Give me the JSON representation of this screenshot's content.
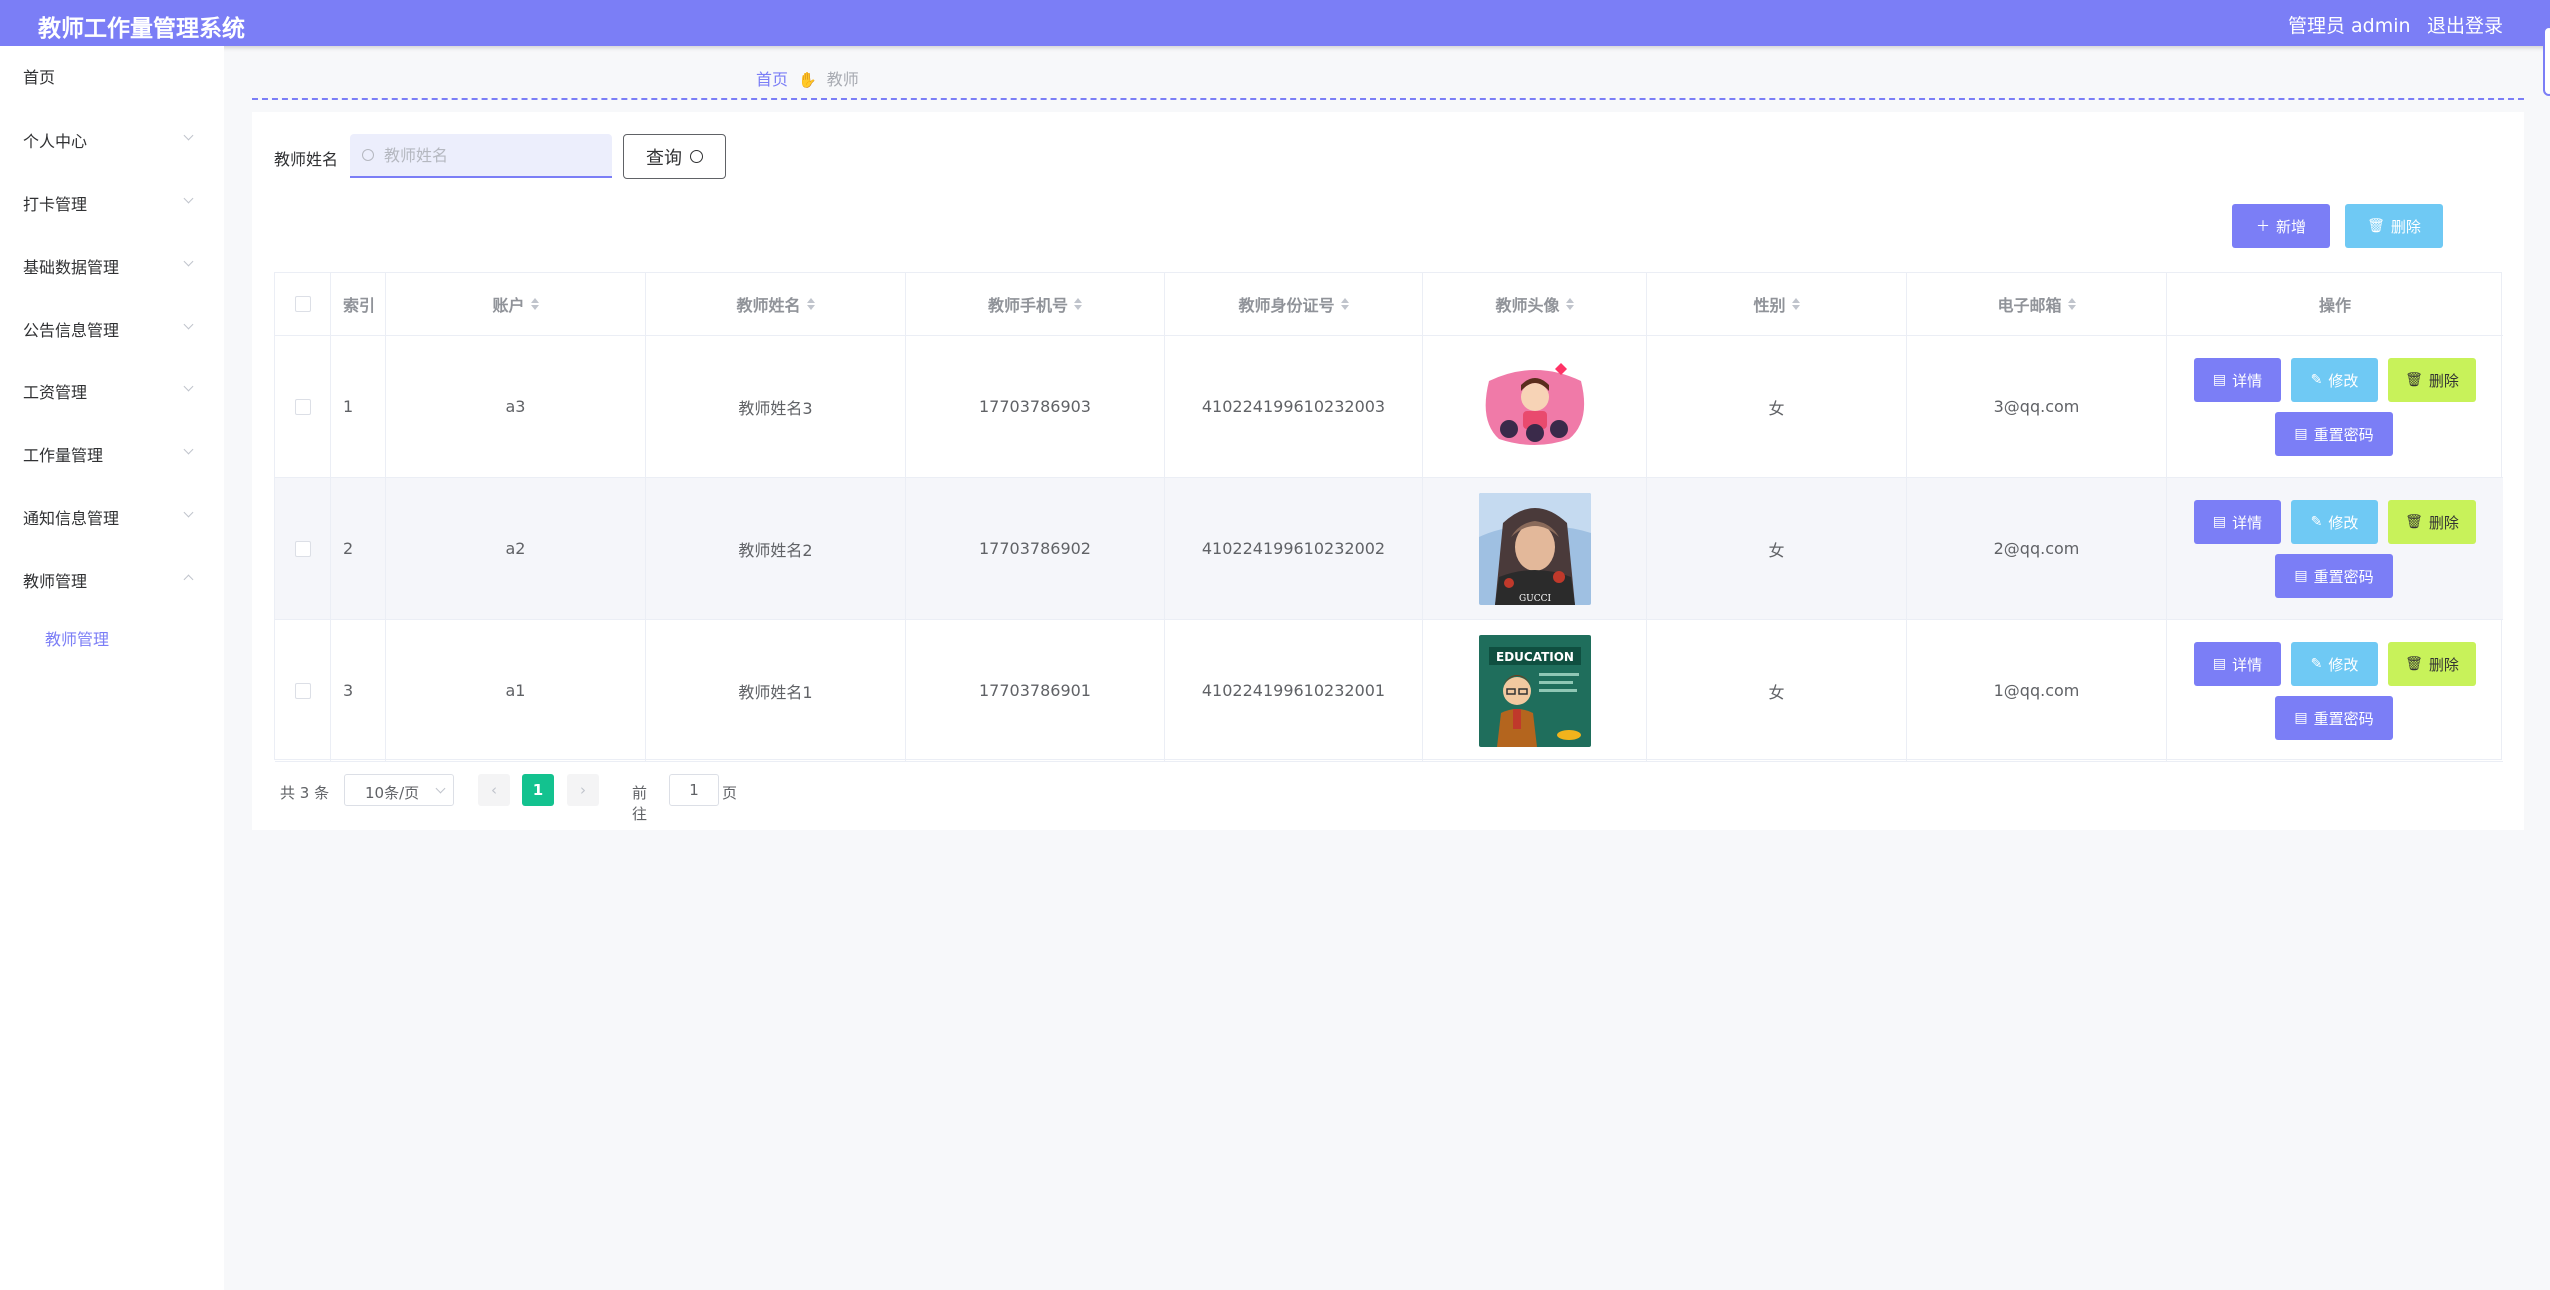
{
  "header": {
    "title": "教师工作量管理系统",
    "admin": "管理员 admin",
    "logout": "退出登录"
  },
  "sidebar": {
    "items": [
      {
        "label": "首页"
      },
      {
        "label": "个人中心"
      },
      {
        "label": "打卡管理"
      },
      {
        "label": "基础数据管理"
      },
      {
        "label": "公告信息管理"
      },
      {
        "label": "工资管理"
      },
      {
        "label": "工作量管理"
      },
      {
        "label": "通知信息管理"
      },
      {
        "label": "教师管理"
      }
    ],
    "active_sub": "教师管理"
  },
  "breadcrumb": {
    "home": "首页",
    "current": "教师"
  },
  "search": {
    "label": "教师姓名",
    "placeholder": "教师姓名",
    "button": "查询"
  },
  "actions": {
    "add": "新增",
    "delete": "删除"
  },
  "table": {
    "columns": {
      "index": "索引",
      "account": "账户",
      "name": "教师姓名",
      "phone": "教师手机号",
      "idcard": "教师身份证号",
      "avatar": "教师头像",
      "gender": "性别",
      "email": "电子邮箱",
      "ops": "操作"
    },
    "rows": [
      {
        "index": "1",
        "account": "a3",
        "name": "教师姓名3",
        "phone": "17703786903",
        "idcard": "410224199610232003",
        "gender": "女",
        "email": "3@qq.com"
      },
      {
        "index": "2",
        "account": "a2",
        "name": "教师姓名2",
        "phone": "17703786902",
        "idcard": "410224199610232002",
        "gender": "女",
        "email": "2@qq.com"
      },
      {
        "index": "3",
        "account": "a1",
        "name": "教师姓名1",
        "phone": "17703786901",
        "idcard": "410224199610232001",
        "gender": "女",
        "email": "1@qq.com"
      }
    ],
    "row_actions": {
      "detail": "详情",
      "edit": "修改",
      "delete": "删除",
      "reset": "重置密码"
    }
  },
  "pager": {
    "total": "共 3 条",
    "page_size": "10条/页",
    "current": "1",
    "goto_label": "前往",
    "goto_value": "1",
    "goto_unit": "页"
  },
  "colors": {
    "primary": "#7b7ef6",
    "info": "#6fc9f4",
    "warning": "#c8f25a",
    "page_active": "#13c28f"
  }
}
